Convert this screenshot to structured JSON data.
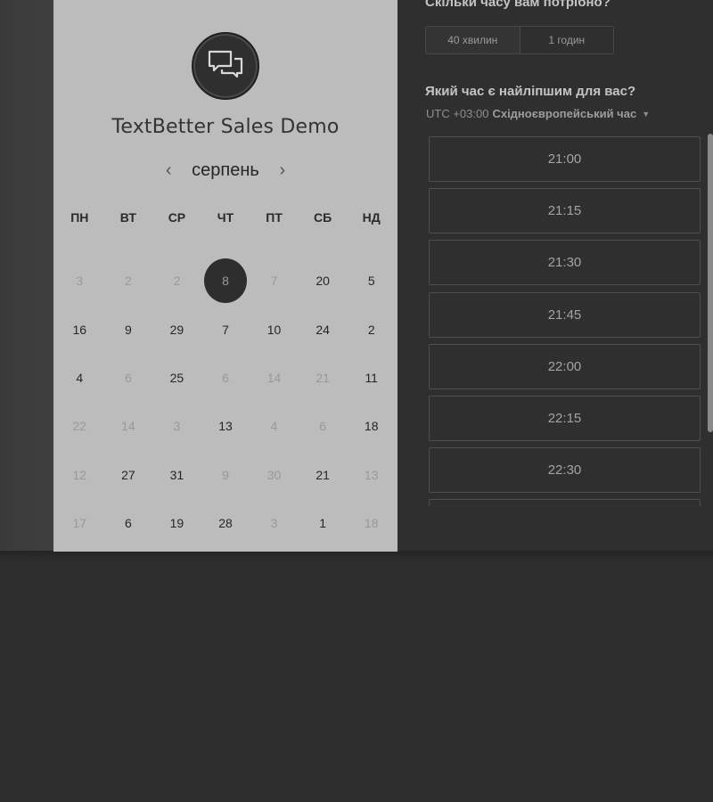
{
  "booking": {
    "brand_title": "TextBetter Sales Demo",
    "month": "серпень",
    "weekdays": [
      "ПН",
      "ВТ",
      "СР",
      "ЧТ",
      "ПТ",
      "СБ",
      "НД"
    ],
    "days": [
      {
        "n": "3",
        "state": "off"
      },
      {
        "n": "2",
        "state": "off"
      },
      {
        "n": "2",
        "state": "off"
      },
      {
        "n": "8",
        "state": "selected"
      },
      {
        "n": "7",
        "state": "off"
      },
      {
        "n": "20",
        "state": "on"
      },
      {
        "n": "5",
        "state": "on"
      },
      {
        "n": "16",
        "state": "on"
      },
      {
        "n": "9",
        "state": "on"
      },
      {
        "n": "29",
        "state": "on"
      },
      {
        "n": "7",
        "state": "on"
      },
      {
        "n": "10",
        "state": "on"
      },
      {
        "n": "24",
        "state": "on"
      },
      {
        "n": "2",
        "state": "on"
      },
      {
        "n": "4",
        "state": "on"
      },
      {
        "n": "6",
        "state": "off"
      },
      {
        "n": "25",
        "state": "on"
      },
      {
        "n": "6",
        "state": "off"
      },
      {
        "n": "14",
        "state": "off"
      },
      {
        "n": "21",
        "state": "off"
      },
      {
        "n": "11",
        "state": "on"
      },
      {
        "n": "22",
        "state": "off"
      },
      {
        "n": "14",
        "state": "off"
      },
      {
        "n": "3",
        "state": "off"
      },
      {
        "n": "13",
        "state": "on"
      },
      {
        "n": "4",
        "state": "off"
      },
      {
        "n": "6",
        "state": "off"
      },
      {
        "n": "18",
        "state": "on"
      },
      {
        "n": "12",
        "state": "off"
      },
      {
        "n": "27",
        "state": "on"
      },
      {
        "n": "31",
        "state": "on"
      },
      {
        "n": "9",
        "state": "off"
      },
      {
        "n": "30",
        "state": "off"
      },
      {
        "n": "21",
        "state": "on"
      },
      {
        "n": "13",
        "state": "off"
      },
      {
        "n": "17",
        "state": "off"
      },
      {
        "n": "6",
        "state": "on"
      },
      {
        "n": "19",
        "state": "on"
      },
      {
        "n": "28",
        "state": "on"
      },
      {
        "n": "3",
        "state": "off"
      },
      {
        "n": "1",
        "state": "on"
      },
      {
        "n": "18",
        "state": "off"
      }
    ],
    "duration_question": "Скільки часу вам потрібно?",
    "durations": [
      "40 хвилин",
      "1 годин"
    ],
    "time_question": "Який час є найліпшим для вас?",
    "timezone_offset": "UTC +03:00",
    "timezone_name": "Східноєвропейський час",
    "slots": [
      "21:00",
      "21:15",
      "21:30",
      "21:45",
      "22:00",
      "22:15",
      "22:30",
      ""
    ]
  },
  "icons": {
    "logo": "chat-bubbles-icon",
    "prev": "chevron-left-icon",
    "next": "chevron-right-icon",
    "timezone_caret": "caret-down-icon"
  },
  "colors": {
    "page_bg": "#2d2d2d",
    "calendar_bg": "#bcbcbc",
    "selected_day_bg": "#2e2e2e"
  }
}
